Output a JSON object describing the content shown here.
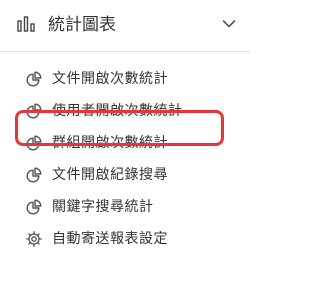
{
  "header": {
    "icon": "bar-chart-icon",
    "title": "統計圖表",
    "toggle_icon": "chevron-down-icon"
  },
  "menu": {
    "items": [
      {
        "label": "文件開啟次數統計",
        "icon": "pie-chart-icon"
      },
      {
        "label": "使用者開啟次數統計",
        "icon": "pie-chart-icon",
        "highlighted": true
      },
      {
        "label": "群組開啟次數統計",
        "icon": "pie-chart-icon"
      },
      {
        "label": "文件開啟紀錄搜尋",
        "icon": "pie-chart-icon"
      },
      {
        "label": "關鍵字搜尋統計",
        "icon": "pie-chart-icon"
      },
      {
        "label": "自動寄送報表設定",
        "icon": "gear-icon"
      }
    ]
  },
  "colors": {
    "text": "#333333",
    "highlight_border": "#e8353a",
    "divider": "#e3e3e3"
  }
}
